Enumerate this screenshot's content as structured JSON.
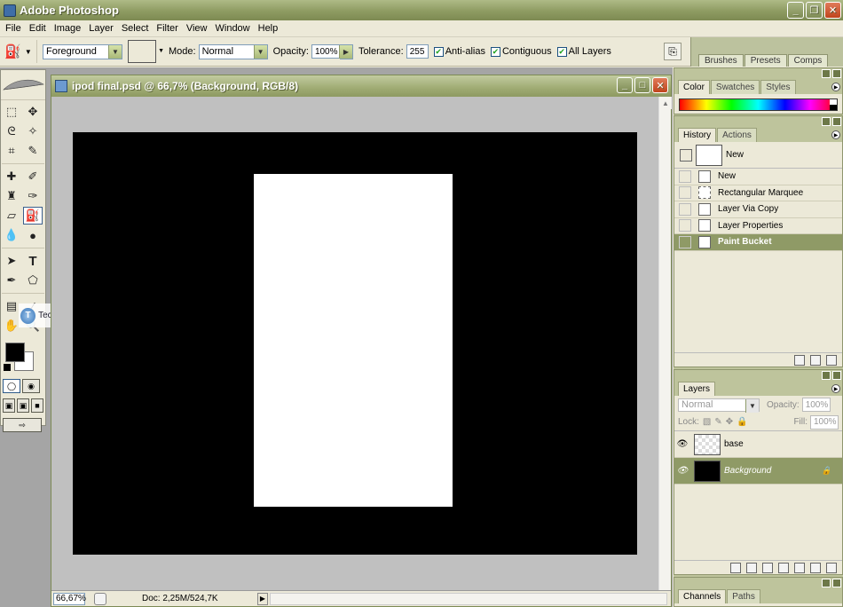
{
  "app": {
    "title": "Adobe Photoshop",
    "menus": [
      "File",
      "Edit",
      "Image",
      "Layer",
      "Select",
      "Filter",
      "View",
      "Window",
      "Help"
    ]
  },
  "options": {
    "fill_source": "Foreground",
    "mode_label": "Mode:",
    "mode_value": "Normal",
    "opacity_label": "Opacity:",
    "opacity_value": "100%",
    "tolerance_label": "Tolerance:",
    "tolerance_value": "255",
    "antialias_label": "Anti-alias",
    "contiguous_label": "Contiguous",
    "all_layers_label": "All Layers",
    "antialias_checked": true,
    "contiguous_checked": true,
    "all_layers_checked": true
  },
  "palette_well": {
    "tabs": [
      "Brushes",
      "Presets",
      "Comps"
    ]
  },
  "watermark": {
    "text": "TechTut.com",
    "logo_letter": "T"
  },
  "document": {
    "title": "ipod final.psd @ 66,7% (Background, RGB/8)",
    "zoom": "66,67%",
    "doc_size": "Doc: 2,25M/524,7K"
  },
  "color_panel": {
    "tabs": [
      "Color",
      "Swatches",
      "Styles"
    ]
  },
  "history_panel": {
    "tabs": [
      "History",
      "Actions"
    ],
    "snapshot": "New",
    "items": [
      "New",
      "Rectangular Marquee",
      "Layer Via Copy",
      "Layer Properties",
      "Paint Bucket"
    ],
    "selected_index": 4
  },
  "layers_panel": {
    "tab": "Layers",
    "blend_mode": "Normal",
    "opacity_label": "Opacity:",
    "opacity_value": "100%",
    "lock_label": "Lock:",
    "fill_label": "Fill:",
    "fill_value": "100%",
    "layers": [
      "base",
      "Background"
    ]
  },
  "channels_panel": {
    "tabs": [
      "Channels",
      "Paths"
    ]
  },
  "colors": {
    "accent": "#8f9a66",
    "titlebar": "#8e9b62",
    "foreground": "#000000",
    "background": "#ffffff"
  }
}
